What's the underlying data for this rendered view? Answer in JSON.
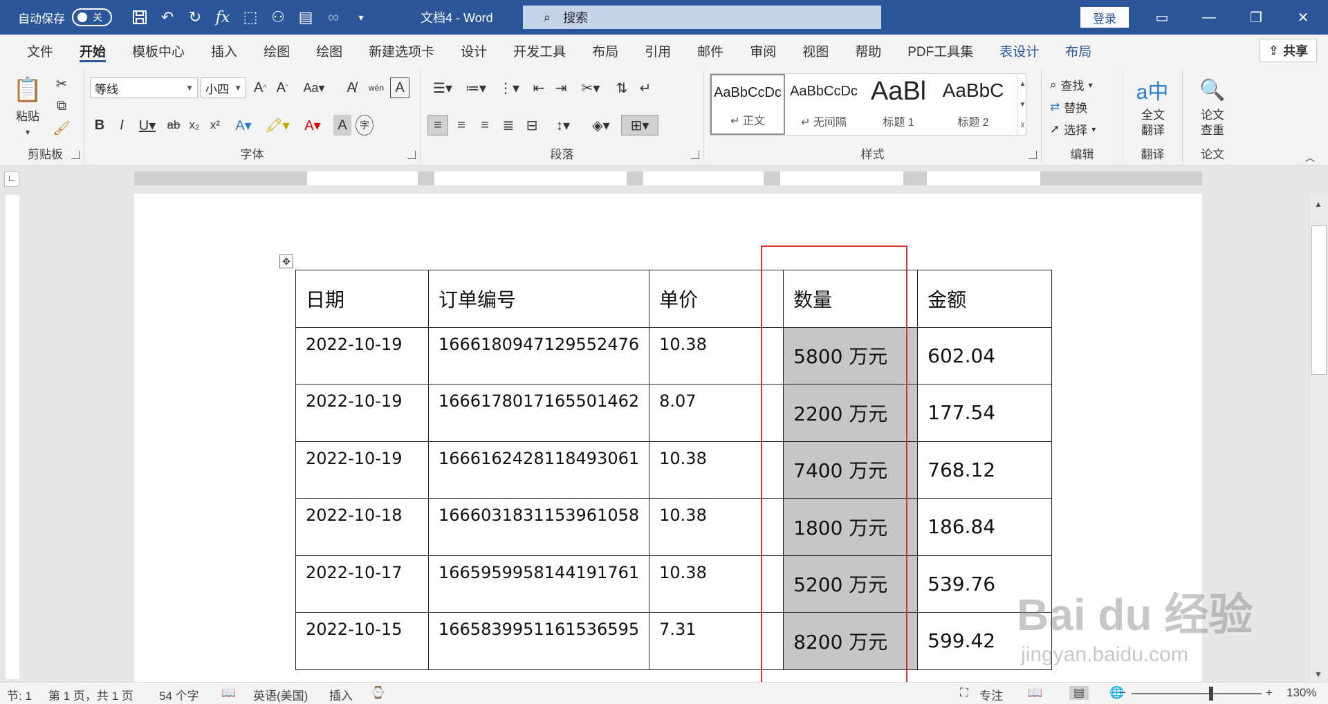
{
  "titlebar": {
    "autosave_label": "自动保存",
    "autosave_state": "关",
    "doc_title": "文档4 - Word",
    "search_placeholder": "搜索",
    "login_label": "登录",
    "accent_color": "#2b579a"
  },
  "tabs": [
    {
      "label": "文件"
    },
    {
      "label": "开始"
    },
    {
      "label": "模板中心"
    },
    {
      "label": "插入"
    },
    {
      "label": "绘图"
    },
    {
      "label": "绘图"
    },
    {
      "label": "新建选项卡"
    },
    {
      "label": "设计"
    },
    {
      "label": "开发工具"
    },
    {
      "label": "布局"
    },
    {
      "label": "引用"
    },
    {
      "label": "邮件"
    },
    {
      "label": "审阅"
    },
    {
      "label": "视图"
    },
    {
      "label": "帮助"
    },
    {
      "label": "PDF工具集"
    },
    {
      "label": "表设计"
    },
    {
      "label": "布局"
    }
  ],
  "share_label": "共享",
  "ribbon": {
    "clipboard": {
      "paste": "粘贴",
      "label": "剪贴板"
    },
    "font": {
      "name": "等线",
      "size": "小四",
      "label": "字体"
    },
    "paragraph": {
      "label": "段落"
    },
    "styles": {
      "label": "样式",
      "items": [
        {
          "sample": "AaBbCcDc",
          "name": "↵ 正文"
        },
        {
          "sample": "AaBbCcDc",
          "name": "↵ 无间隔"
        },
        {
          "sample": "AaBl",
          "name": "标题 1"
        },
        {
          "sample": "AaBbC",
          "name": "标题 2"
        }
      ]
    },
    "editing": {
      "find": "查找",
      "replace": "替换",
      "select": "选择",
      "label": "编辑"
    },
    "translate": {
      "button": "全文\n翻译",
      "label": "翻译"
    },
    "paper": {
      "button": "论文\n查重",
      "label": "论文"
    }
  },
  "table": {
    "headers": [
      "日期",
      "订单编号",
      "单价",
      "数量",
      "金额"
    ],
    "rows": [
      [
        "2022-10-19",
        "1666180947129552476",
        "10.38",
        "5800 万元",
        "602.04"
      ],
      [
        "2022-10-19",
        "1666178017165501462",
        "8.07",
        "2200 万元",
        "177.54"
      ],
      [
        "2022-10-19",
        "1666162428118493061",
        "10.38",
        "7400 万元",
        "768.12"
      ],
      [
        "2022-10-18",
        "1666031831153961058",
        "10.38",
        "1800 万元",
        "186.84"
      ],
      [
        "2022-10-17",
        "1665959958144191761",
        "10.38",
        "5200 万元",
        "539.76"
      ],
      [
        "2022-10-15",
        "1665839951161536595",
        "7.31",
        "8200 万元",
        "599.42"
      ]
    ]
  },
  "statusbar": {
    "section": "节: 1",
    "page": "第 1 页，共 1 页",
    "words": "54 个字",
    "language": "英语(美国)",
    "mode": "插入",
    "focus": "专注",
    "zoom": "130%"
  },
  "watermark": {
    "main": "Bai du 经验",
    "sub": "jingyan.baidu.com"
  }
}
